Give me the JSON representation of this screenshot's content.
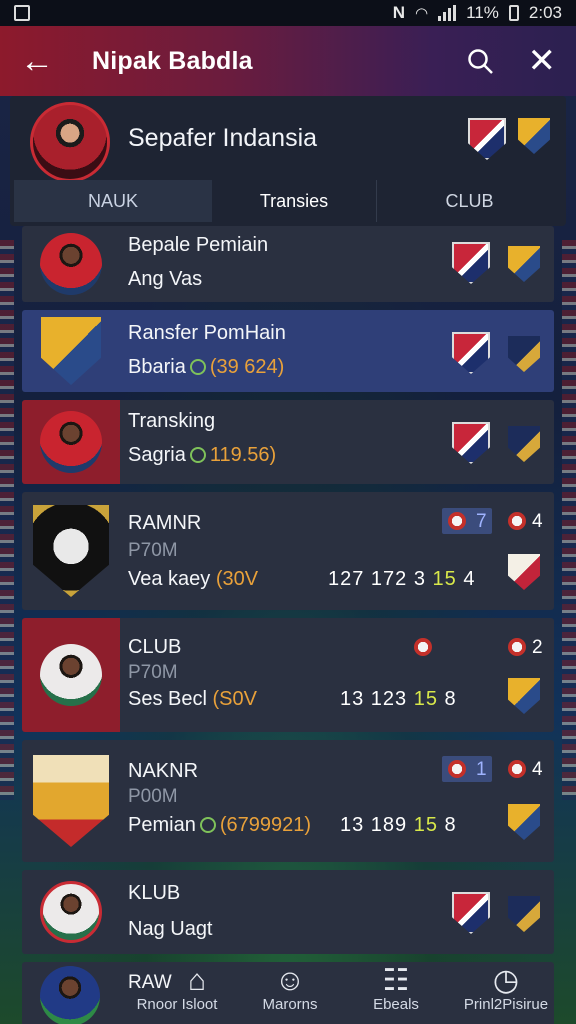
{
  "status_bar": {
    "notification_icon": "image-icon",
    "nfc_icon": "N",
    "battery_text": "11%",
    "time": "2:03"
  },
  "app_bar": {
    "title": "Nipak Babdla",
    "back_icon": "arrow-left-icon",
    "search_icon": "search-icon",
    "close_icon": "close-icon"
  },
  "header": {
    "title": "Sepafer Indansia"
  },
  "tabs": [
    {
      "label": "NAUK",
      "active": true
    },
    {
      "label": "Transies",
      "active": false
    },
    {
      "label": "CLUB",
      "active": false
    }
  ],
  "rows": [
    {
      "line1": "Bepale Pemiain",
      "line2": "Ang Vas"
    },
    {
      "line1": "Ransfer PomHain",
      "line2_name": "Bbaria",
      "amount": "(39 624)"
    },
    {
      "line1": "Transking",
      "line2_name": "Sagria",
      "amount": "119.56)"
    },
    {
      "line1": "RAMNR",
      "muted": "P70M",
      "line2_name": "Vea kaey",
      "amount": "(30V",
      "stats_a": "127 172 3",
      "stats_hl": "15",
      "stats_b": "4",
      "chip_num": "7",
      "side_num": "4"
    },
    {
      "line1": "CLUB",
      "muted": "P70M",
      "line2_name": "Ses Becl",
      "amount": "(S0V",
      "stats_a": "13 123",
      "stats_hl": "15",
      "stats_b": "8",
      "side_num": "2"
    },
    {
      "line1": "NAKNR",
      "muted": "P00M",
      "line2_name": "Pemian",
      "amount": "(6799921)",
      "stats_a": "13 189",
      "stats_hl": "15",
      "stats_b": "8",
      "chip_num": "1",
      "side_num": "4"
    },
    {
      "line1": "KLUB",
      "line2": "Nag Uagt"
    }
  ],
  "bottom_nav": {
    "row_label": "RAW",
    "items": [
      {
        "label": "Rnoor Isloot",
        "icon": "home-icon"
      },
      {
        "label": "Marorns",
        "icon": "person-icon"
      },
      {
        "label": "Ebeals",
        "icon": "stats-icon"
      },
      {
        "label": "Prinl2Pisirue",
        "icon": "clock-icon"
      }
    ]
  }
}
